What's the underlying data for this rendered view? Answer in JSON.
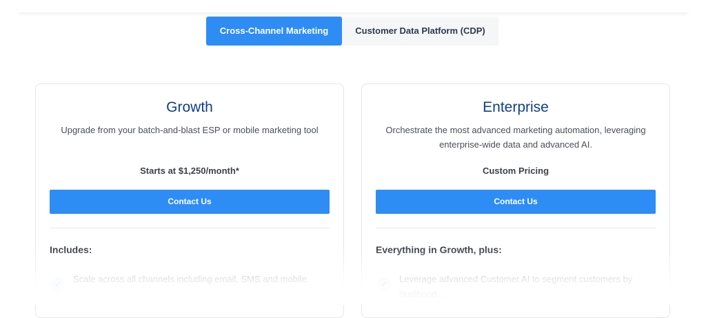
{
  "tabs": [
    {
      "label": "Cross-Channel Marketing",
      "active": true
    },
    {
      "label": "Customer Data Platform (CDP)",
      "active": false
    }
  ],
  "plans": [
    {
      "title": "Growth",
      "description": "Upgrade from your batch-and-blast ESP or mobile marketing tool",
      "price": "Starts at $1,250/month*",
      "cta": "Contact Us",
      "includes_heading": "Includes:",
      "features": [
        "Scale across all channels including email, SMS and mobile"
      ]
    },
    {
      "title": "Enterprise",
      "description": "Orchestrate the most advanced marketing automation, leveraging enterprise-wide data and advanced AI.",
      "price": "Custom Pricing",
      "cta": "Contact Us",
      "includes_heading": "Everything in Growth, plus:",
      "features": [
        "Leverage advanced Customer AI to segment customers by likelihood..."
      ]
    }
  ],
  "icons": {
    "feature_check": "check-icon"
  },
  "colors": {
    "accent": "#2e8cf5",
    "title": "#0f3d8a",
    "tab_inactive_bg": "#f5f6f8"
  }
}
